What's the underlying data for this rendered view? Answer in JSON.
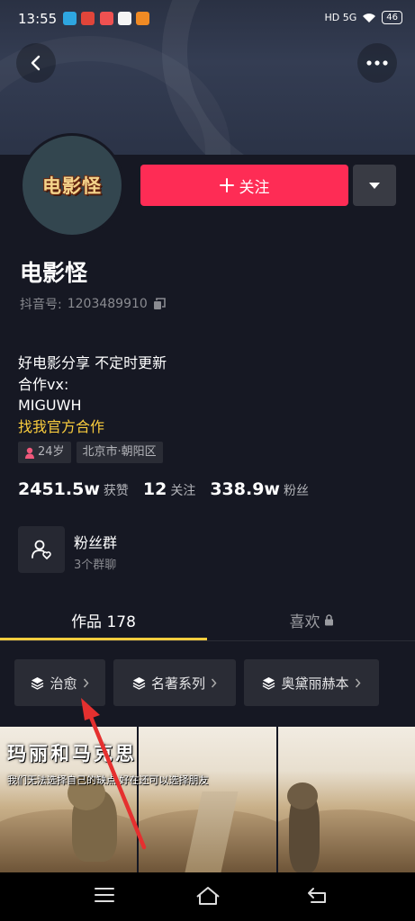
{
  "status_bar": {
    "time": "13:55",
    "right_icons": "HD 5G",
    "battery": "46"
  },
  "header": {
    "back_icon": "chevron-left-icon",
    "more_icon": "more-dots-icon"
  },
  "profile": {
    "avatar_text": "电影怪",
    "follow_label": "关注",
    "name": "电影怪",
    "douyin_id_label": "抖音号:",
    "douyin_id": "1203489910",
    "bio_lines": [
      "好电影分享 不定时更新",
      "合作vx:",
      "MIGUWH"
    ],
    "official_link": "找我官方合作",
    "tags": {
      "age": "24岁",
      "location": "北京市·朝阳区"
    }
  },
  "stats": {
    "likes_value": "2451.5w",
    "likes_label": "获赞",
    "following_value": "12",
    "following_label": "关注",
    "fans_value": "338.9w",
    "fans_label": "粉丝"
  },
  "fan_group": {
    "title": "粉丝群",
    "subtitle": "3个群聊"
  },
  "tabs": {
    "works_label": "作品 178",
    "likes_label": "喜欢"
  },
  "collections": [
    {
      "label": "治愈"
    },
    {
      "label": "名著系列"
    },
    {
      "label": "奥黛丽赫本"
    }
  ],
  "video": {
    "title": "玛丽和马克思",
    "subtitle": "我们无法选择自己的缺点  好在还可以选择朋友"
  },
  "colors": {
    "accent_red": "#fe2c55",
    "link_yellow": "#facd3e",
    "background": "#161823",
    "annotation_arrow": "#e5302f"
  }
}
